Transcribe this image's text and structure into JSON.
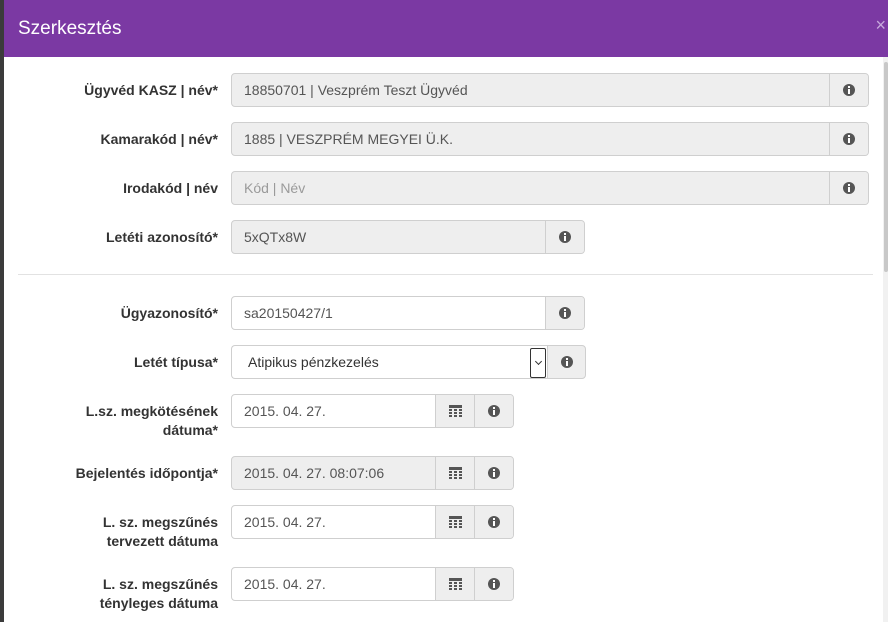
{
  "modal": {
    "title": "Szerkesztés",
    "close_glyph": "×"
  },
  "fields": {
    "ugyved": {
      "label": "Ügyvéd KASZ | név*",
      "value": "18850701 | Veszprém Teszt Ügyvéd"
    },
    "kamara": {
      "label": "Kamarakód | név*",
      "value": "1885 | VESZPRÉM MEGYEI Ü.K."
    },
    "iroda": {
      "label": "Irodakód | név",
      "placeholder": "Kód | Név"
    },
    "leteti": {
      "label": "Letéti azonosító*",
      "value": "5xQTx8W"
    },
    "ugyazon": {
      "label": "Ügyazonosító*",
      "value": "sa20150427/1"
    },
    "letet_tipus": {
      "label": "Letét típusa*",
      "value": "Atipikus pénzkezelés"
    },
    "megkotes": {
      "label_line1": "L.sz. megkötésének",
      "label_line2": "dátuma*",
      "value": "2015. 04. 27."
    },
    "bejelentes": {
      "label": "Bejelentés időpontja*",
      "value": "2015. 04. 27. 08:07:06"
    },
    "tervezett": {
      "label_line1": "L. sz. megszűnés",
      "label_line2": "tervezett dátuma",
      "value": "2015. 04. 27."
    },
    "tenyleges": {
      "label_line1": "L. sz. megszűnés",
      "label_line2": "tényleges dátuma",
      "value": "2015. 04. 27."
    }
  },
  "icons": {
    "info": "info-circle-icon",
    "calendar": "calendar-icon",
    "close": "close-icon"
  },
  "colors": {
    "header": "#7b39a3",
    "readonly_bg": "#eeeeee",
    "icon": "#555555"
  }
}
